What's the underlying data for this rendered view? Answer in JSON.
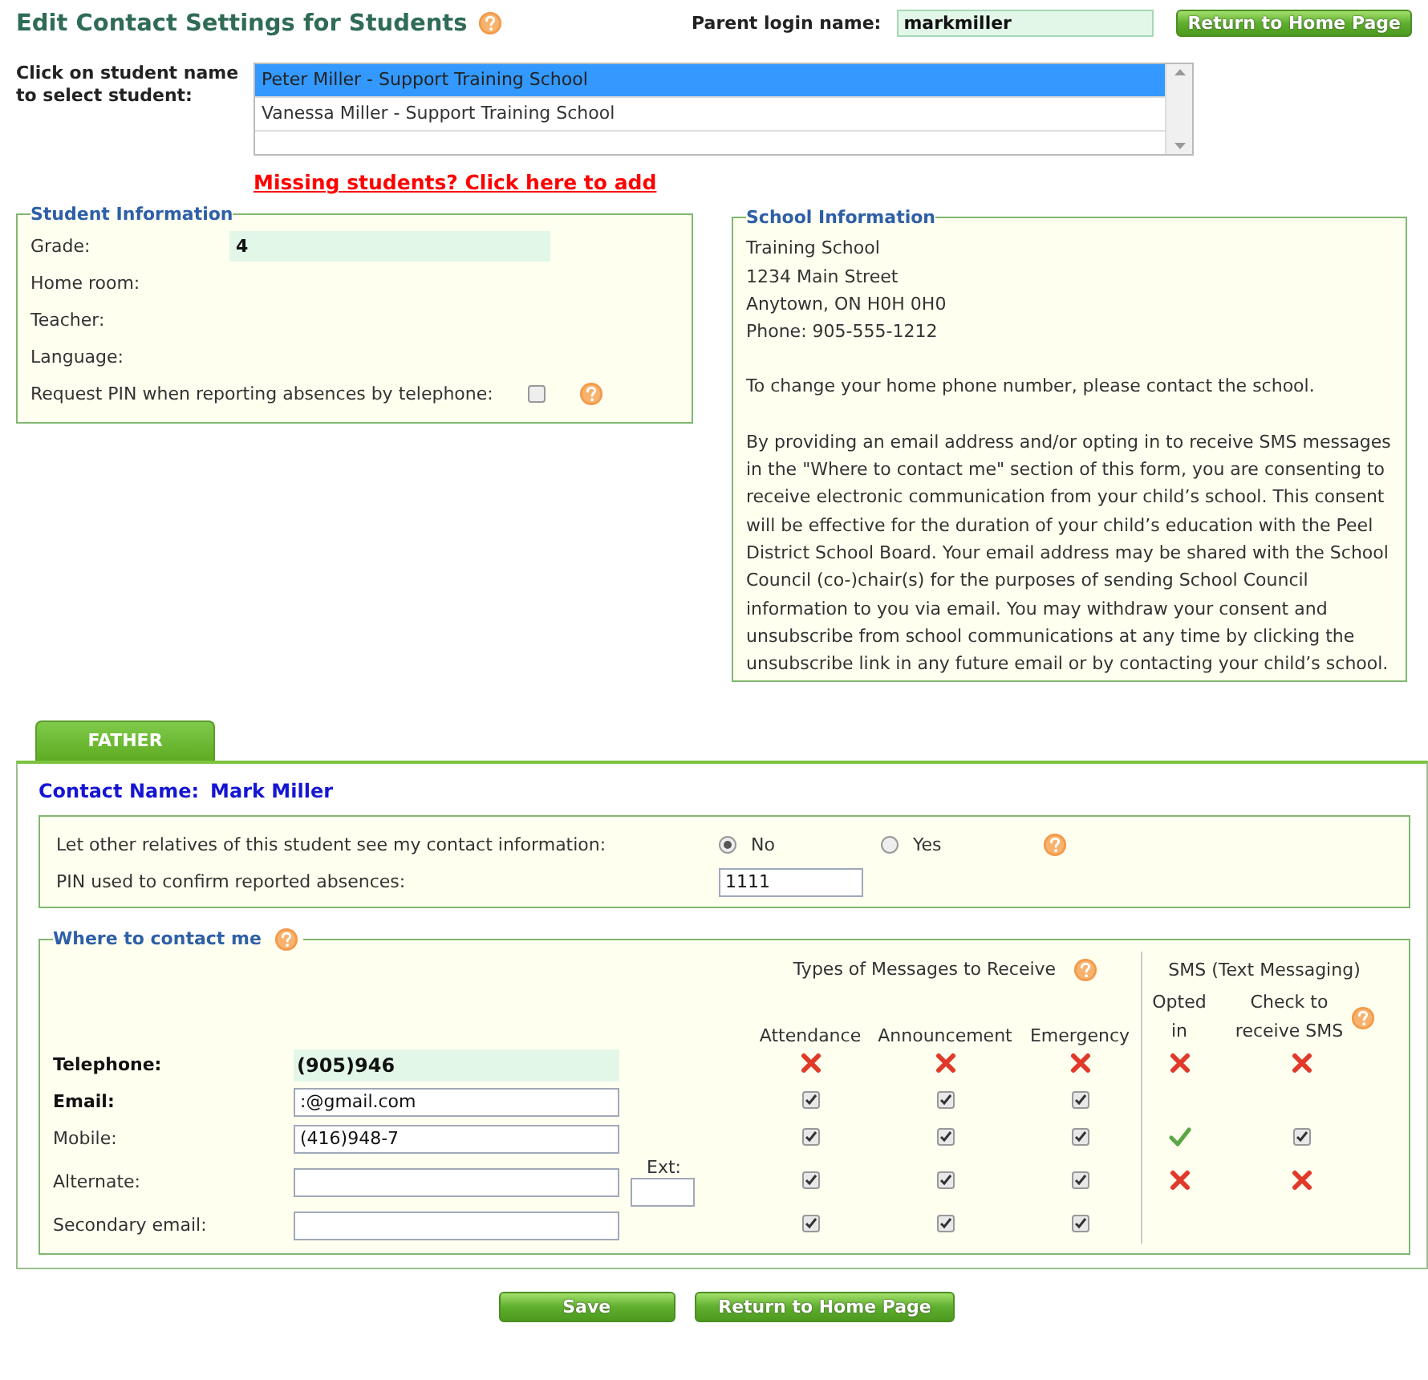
{
  "header": {
    "title": "Edit Contact Settings for Students",
    "login_label": "Parent login name:",
    "login_value": "markmiller",
    "return_button": "Return to Home Page"
  },
  "student_picker": {
    "label": "Click on student name to select student:",
    "students": [
      {
        "name": "Peter Miller - Support Training School",
        "selected": true
      },
      {
        "name": "Vanessa Miller - Support Training School",
        "selected": false
      }
    ],
    "missing_link": "Missing students? Click here to add"
  },
  "student_info": {
    "legend": "Student Information",
    "fields": [
      {
        "label": "Grade:",
        "value": "4"
      },
      {
        "label": "Home room:"
      },
      {
        "label": "Teacher:"
      },
      {
        "label": "Language:"
      }
    ],
    "pin_request": {
      "label": "Request PIN when reporting absences by telephone:",
      "checked": false
    }
  },
  "school_info": {
    "legend": "School Information",
    "address_lines": [
      "Training School",
      "1234 Main Street",
      "Anytown, ON H0H 0H0",
      "Phone: 905-555-1212"
    ],
    "notes": [
      "To change your home phone number, please contact the school.",
      "By providing an email address and/or opting in to receive SMS messages in the \"Where to contact me\" section of this form, you are consenting to receive electronic communication from your child’s school. This consent will be effective for the duration of your child’s education with the Peel District School Board. Your email address may be shared with the School Council (co-)chair(s) for the purposes of sending School Council information to you via email. You may withdraw your consent and unsubscribe from school communications at any time by clicking the unsubscribe link in any future email or by contacting your child’s school."
    ]
  },
  "tabs": [
    {
      "label": "FATHER",
      "selected": true
    }
  ],
  "contact": {
    "name_label": "Contact Name:",
    "name_value": "Mark Miller",
    "sharing": {
      "label": "Let other relatives of this student see my contact information:",
      "options": [
        {
          "label": "No",
          "selected": true
        },
        {
          "label": "Yes",
          "selected": false
        }
      ]
    },
    "pin": {
      "label": "PIN used to confirm reported absences:",
      "value": "1111"
    }
  },
  "where": {
    "legend": "Where to contact me",
    "types_heading": "Types of Messages to Receive",
    "sms_heading": "SMS (Text Messaging)",
    "type_columns": [
      "Attendance",
      "Announcement",
      "Emergency"
    ],
    "sms_columns": [
      "Opted in",
      "Check to receive SMS"
    ],
    "rows": [
      {
        "label": "Telephone:",
        "bold": true,
        "kind": "readonly",
        "value": "(905)946",
        "types": [
          {
            "kind": "cross"
          },
          {
            "kind": "cross"
          },
          {
            "kind": "cross"
          }
        ],
        "sms": [
          {
            "kind": "cross"
          },
          {
            "kind": "cross"
          }
        ]
      },
      {
        "label": "Email:",
        "bold": true,
        "kind": "input",
        "value": ":@gmail.com",
        "types": [
          {
            "kind": "checkbox",
            "checked": true
          },
          {
            "kind": "checkbox",
            "checked": true
          },
          {
            "kind": "checkbox",
            "checked": true
          }
        ]
      },
      {
        "label": "Mobile:",
        "bold": false,
        "kind": "input",
        "value": "(416)948-7",
        "types": [
          {
            "kind": "checkbox",
            "checked": true
          },
          {
            "kind": "checkbox",
            "checked": true
          },
          {
            "kind": "checkbox",
            "checked": true
          }
        ],
        "sms": [
          {
            "kind": "tick"
          },
          {
            "kind": "checkbox",
            "checked": true
          }
        ]
      },
      {
        "label": "Alternate:",
        "bold": false,
        "kind": "input",
        "ext_label": "Ext:",
        "types": [
          {
            "kind": "checkbox",
            "checked": true
          },
          {
            "kind": "checkbox",
            "checked": true
          },
          {
            "kind": "checkbox",
            "checked": true
          }
        ],
        "sms": [
          {
            "kind": "cross"
          },
          {
            "kind": "cross"
          }
        ]
      },
      {
        "label": "Secondary email:",
        "bold": false,
        "kind": "input",
        "types": [
          {
            "kind": "checkbox",
            "checked": true
          },
          {
            "kind": "checkbox",
            "checked": true
          },
          {
            "kind": "checkbox",
            "checked": true
          }
        ]
      }
    ]
  },
  "footer_buttons": [
    "Save",
    "Return to Home Page"
  ]
}
